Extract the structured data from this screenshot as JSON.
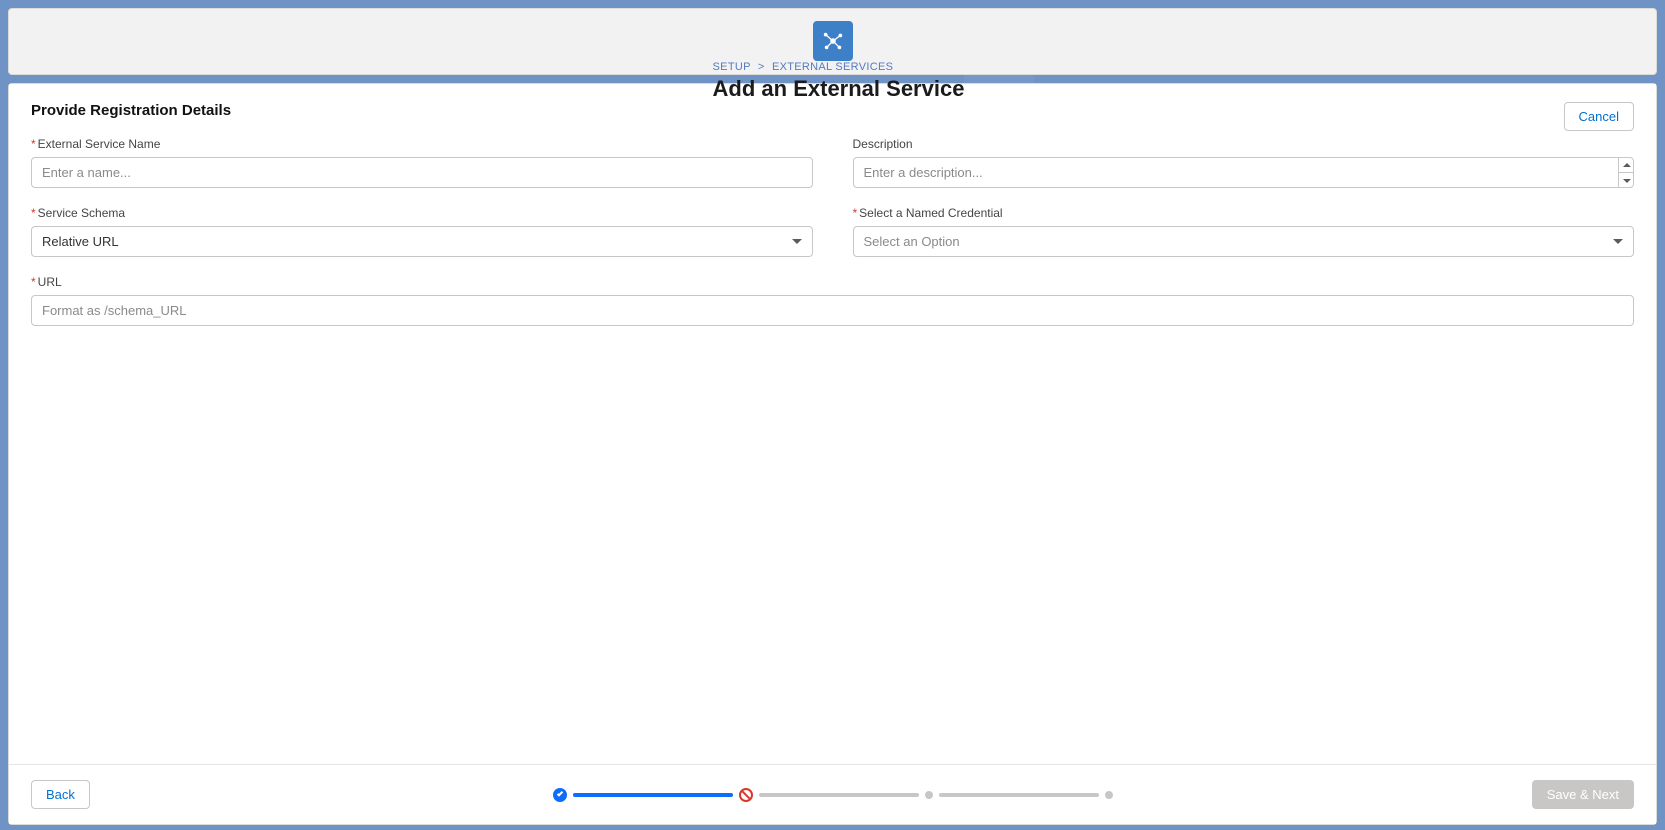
{
  "breadcrumb": {
    "level1": "SETUP",
    "sep": ">",
    "level2": "EXTERNAL SERVICES"
  },
  "header": {
    "title": "Add an External Service",
    "cancel_label": "Cancel"
  },
  "section": {
    "title": "Provide Registration Details"
  },
  "fields": {
    "service_name": {
      "label": "External Service Name",
      "placeholder": "Enter a name...",
      "value": ""
    },
    "description": {
      "label": "Description",
      "placeholder": "Enter a description...",
      "value": ""
    },
    "service_schema": {
      "label": "Service Schema",
      "value": "Relative URL"
    },
    "named_credential": {
      "label": "Select a Named Credential",
      "placeholder": "Select an Option",
      "value": ""
    },
    "url": {
      "label": "URL",
      "placeholder": "Format as /schema_URL",
      "value": ""
    }
  },
  "footer": {
    "back_label": "Back",
    "save_label": "Save & Next"
  },
  "progress": {
    "steps": [
      {
        "state": "done"
      },
      {
        "state": "error"
      },
      {
        "state": "future"
      },
      {
        "state": "future"
      }
    ]
  }
}
